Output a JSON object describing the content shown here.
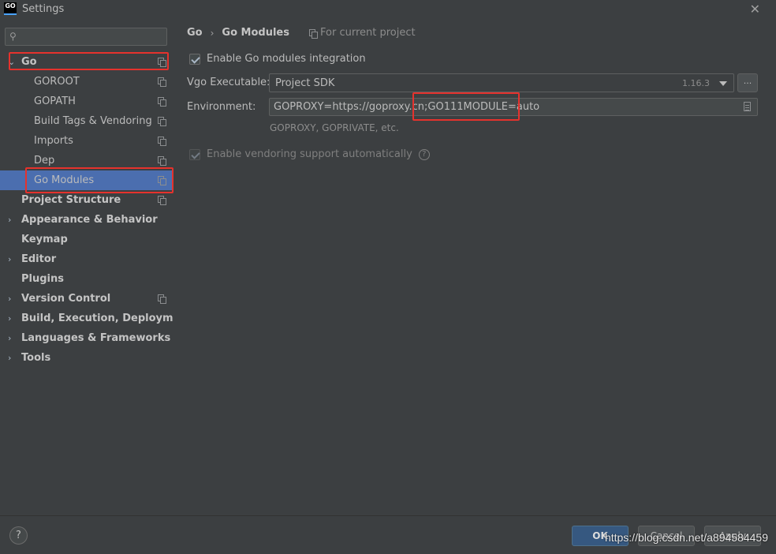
{
  "window": {
    "title": "Settings",
    "app_icon_text": "GO",
    "close_glyph": "✕"
  },
  "sidebar": {
    "search": {
      "value": "",
      "placeholder": ""
    },
    "items": [
      {
        "label": "Go",
        "expanded": true
      },
      {
        "label": "GOROOT"
      },
      {
        "label": "GOPATH"
      },
      {
        "label": "Build Tags & Vendoring"
      },
      {
        "label": "Imports"
      },
      {
        "label": "Dep"
      },
      {
        "label": "Go Modules",
        "selected": true
      },
      {
        "label": "Project Structure"
      },
      {
        "label": "Appearance & Behavior"
      },
      {
        "label": "Keymap"
      },
      {
        "label": "Editor"
      },
      {
        "label": "Plugins"
      },
      {
        "label": "Version Control"
      },
      {
        "label": "Build, Execution, Deployment"
      },
      {
        "label": "Languages & Frameworks"
      },
      {
        "label": "Tools"
      }
    ]
  },
  "breadcrumb": {
    "parent": "Go",
    "separator": "›",
    "current": "Go Modules"
  },
  "scope_note": "For current project",
  "form": {
    "enable_modules": {
      "label": "Enable Go modules integration",
      "checked": true
    },
    "vgo_executable": {
      "label": "Vgo Executable:",
      "value": "Project SDK",
      "version": "1.16.3",
      "browse_label": "..."
    },
    "environment": {
      "label": "Environment:",
      "value": "GOPROXY=https://goproxy.cn;GO111MODULE=auto",
      "hint": "GOPROXY, GOPRIVATE, etc."
    },
    "vendoring": {
      "label": "Enable vendoring support automatically",
      "checked": true,
      "enabled": false,
      "help_glyph": "?"
    }
  },
  "footer": {
    "help_glyph": "?",
    "ok_label": "OK",
    "cancel_label": "Cancel",
    "apply_label": "Apply",
    "watermark": "https://blog.csdn.net/a894584459"
  },
  "colors": {
    "background": "#3c3f41",
    "selection": "#4b6eaf",
    "highlight_box": "#e5322d",
    "primary_button": "#365880"
  }
}
